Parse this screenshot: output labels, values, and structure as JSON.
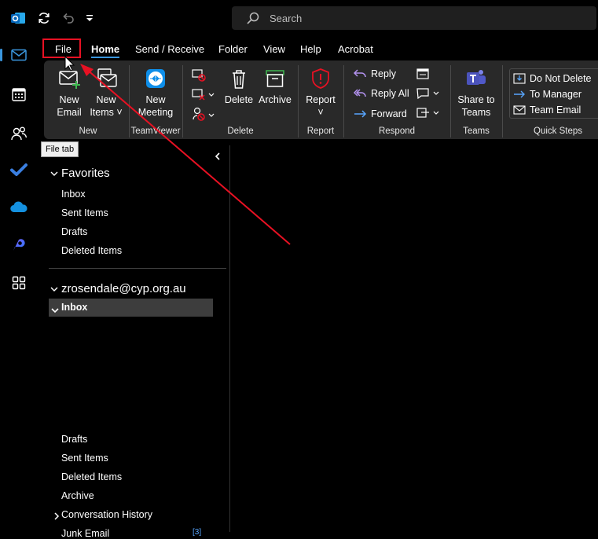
{
  "search": {
    "placeholder": "Search"
  },
  "menu": {
    "tabs": [
      "File",
      "Home",
      "Send / Receive",
      "Folder",
      "View",
      "Help",
      "Acrobat"
    ]
  },
  "ribbon": {
    "new": {
      "new_email": [
        "New",
        "Email"
      ],
      "new_items": [
        "New",
        "Items ˅"
      ],
      "label": "New"
    },
    "teamviewer": {
      "new_meeting": [
        "New",
        "Meeting"
      ],
      "label": "TeamViewer"
    },
    "delete": {
      "delete": "Delete",
      "archive": "Archive",
      "label": "Delete"
    },
    "report": {
      "report": "Report",
      "label": "Report"
    },
    "respond": {
      "reply": "Reply",
      "reply_all": "Reply All",
      "forward": "Forward",
      "label": "Respond"
    },
    "teams": {
      "share": [
        "Share to",
        "Teams"
      ],
      "label": "Teams"
    },
    "quick_steps": {
      "items": [
        "Do Not Delete",
        "To Manager",
        "Team Email"
      ],
      "label": "Quick Steps"
    }
  },
  "tooltip": "File tab",
  "favorites": {
    "title": "Favorites",
    "items": [
      "Inbox",
      "Sent Items",
      "Drafts",
      "Deleted Items"
    ]
  },
  "account": {
    "email": "zrosendale@cyp.org.au",
    "inbox": "Inbox",
    "items": [
      "Drafts",
      "Sent Items",
      "Deleted Items",
      "Archive",
      "Conversation History",
      "Junk Email"
    ],
    "junk_count": "[3]"
  },
  "colors": {
    "accent": "#3a96dd",
    "annotation": "#e81123"
  }
}
